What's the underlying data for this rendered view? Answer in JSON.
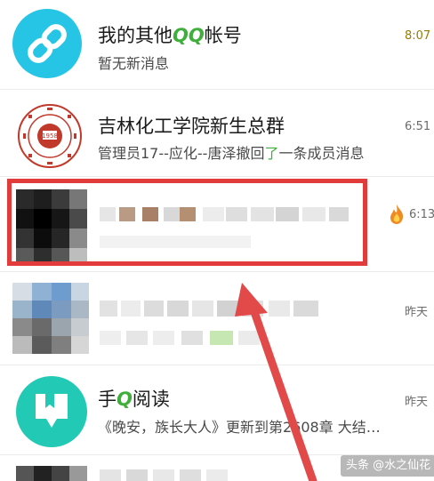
{
  "chats": [
    {
      "name": "我的其他QQ帐号",
      "name_prefix": "我的其他",
      "name_highlight": "QQ",
      "name_suffix": "帐号",
      "message": "暂无新消息",
      "time": "8:07",
      "icon": "link-icon"
    },
    {
      "name": "吉林化工学院新生总群",
      "message_prefix": "管理员17--应化--唐泽撤回",
      "message_highlight": "了",
      "message_suffix": "一条成员消息",
      "time": "6:51",
      "icon": "college-seal-icon"
    },
    {
      "name": "",
      "message": "",
      "time": "6:13",
      "icon": "flame-icon",
      "blurred": true
    },
    {
      "name": "",
      "message": "",
      "time": "昨天",
      "blurred": true
    },
    {
      "name": "手Q阅读",
      "name_prefix": "手",
      "name_highlight": "Q",
      "name_suffix": "阅读",
      "message": "《晚安，族长大人》更新到第2608章  大结…",
      "time": "昨天",
      "icon": "bookmark-book-icon"
    }
  ],
  "colors": {
    "teal": "#26c5e6",
    "reader_green": "#22c9b4",
    "highlight_box": "#e23b3b",
    "arrow": "#e24a4a",
    "highlight_text_green": "#3fae3a"
  },
  "watermark": "头条 @水之仙花"
}
